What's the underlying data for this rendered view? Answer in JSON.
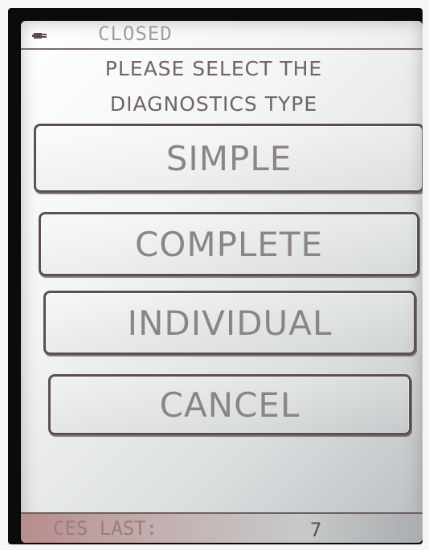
{
  "status_bar": {
    "icon": "plug-icon",
    "state_text": "CLOSED"
  },
  "prompt": {
    "line1": "PLEASE SELECT THE",
    "line2": "DIAGNOSTICS TYPE"
  },
  "menu": {
    "options": [
      {
        "label": "SIMPLE"
      },
      {
        "label": "COMPLETE"
      },
      {
        "label": "INDIVIDUAL"
      },
      {
        "label": "CANCEL"
      }
    ]
  },
  "footer": {
    "label": "CES LAST:",
    "value": "7"
  },
  "colors": {
    "screen_background": "#f3f4f4",
    "button_border": "#5d4f51",
    "button_text": "#8c8486",
    "prompt_text": "#6f6466"
  }
}
